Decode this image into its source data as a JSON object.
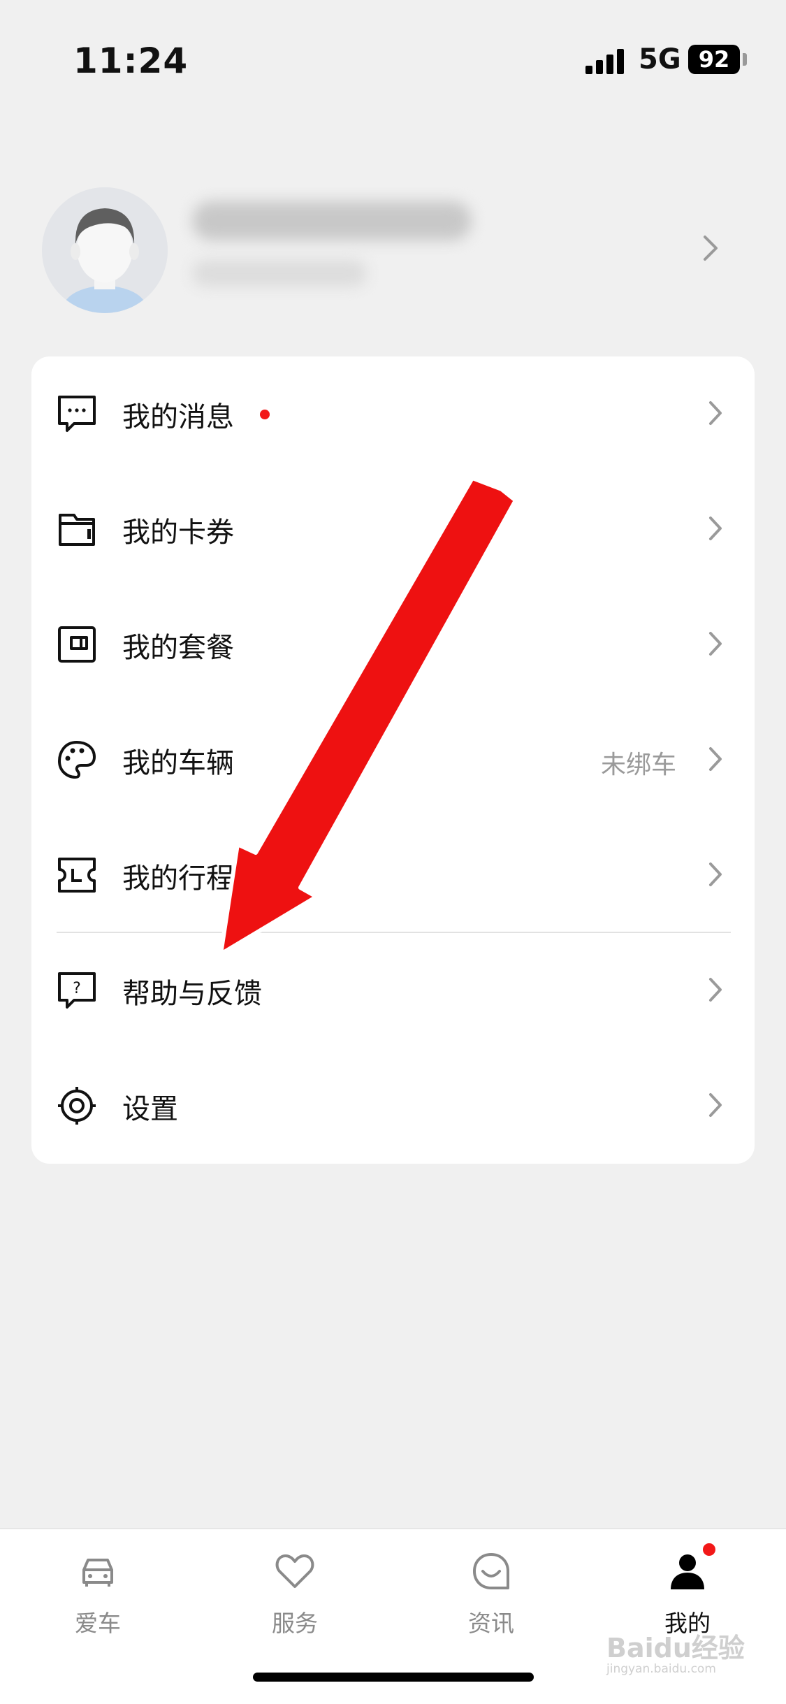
{
  "status": {
    "time": "11:24",
    "network": "5G",
    "battery": "92"
  },
  "menu": [
    {
      "label": "我的消息",
      "icon": "message-icon",
      "badge": true
    },
    {
      "label": "我的卡券",
      "icon": "wallet-icon"
    },
    {
      "label": "我的套餐",
      "icon": "package-icon"
    },
    {
      "label": "我的车辆",
      "icon": "palette-icon",
      "extra": "未绑车"
    },
    {
      "label": "我的行程",
      "icon": "ticket-icon"
    },
    {
      "label": "帮助与反馈",
      "icon": "help-icon"
    },
    {
      "label": "设置",
      "icon": "settings-icon"
    }
  ],
  "tabs": [
    {
      "label": "爱车",
      "icon": "car-icon"
    },
    {
      "label": "服务",
      "icon": "heart-icon"
    },
    {
      "label": "资讯",
      "icon": "chat-smile-icon"
    },
    {
      "label": "我的",
      "icon": "person-icon",
      "active": true
    }
  ],
  "watermark": {
    "text": "Baidu经验",
    "url": "jingyan.baidu.com"
  },
  "colors": {
    "accent_red": "#f21818",
    "background": "#f0f0f0",
    "card": "#ffffff",
    "muted_text": "#9a9a9a"
  }
}
